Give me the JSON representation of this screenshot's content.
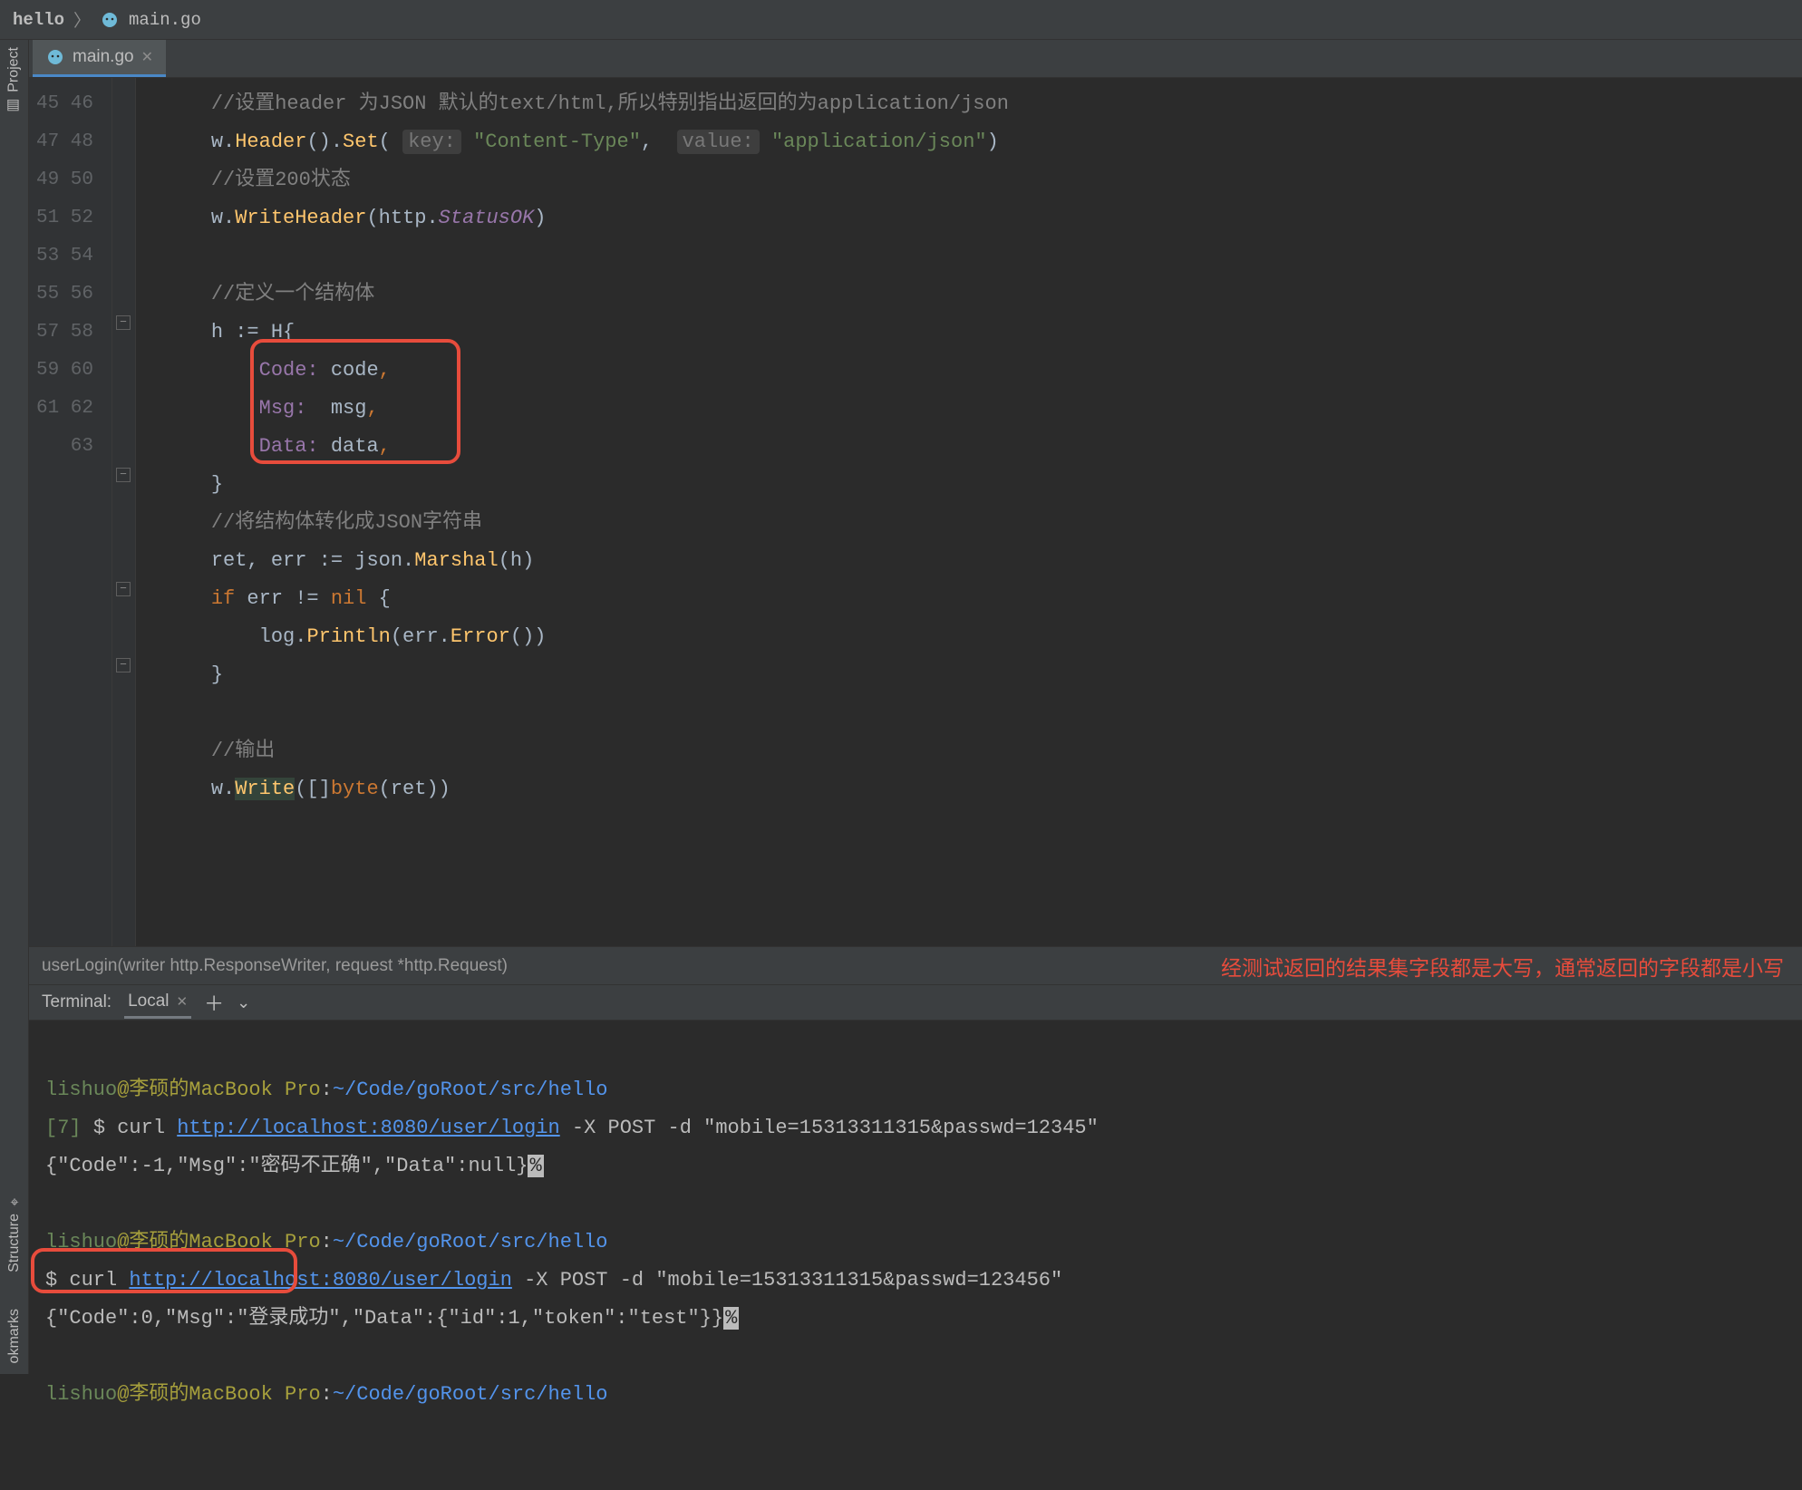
{
  "breadcrumb": {
    "root": "hello",
    "file": "main.go"
  },
  "tab": {
    "label": "main.go"
  },
  "rail": {
    "project": "Project",
    "structure": "Structure",
    "bookmarks": "okmarks"
  },
  "code": {
    "line_start": 45,
    "l45": "//设置header 为JSON 默认的text/html,所以特别指出返回的为application/json",
    "l46_pre": "w.",
    "l46_fn1": "Header",
    "l46_mid1": "().",
    "l46_fn2": "Set",
    "l46_open": "(",
    "l46_hint1": "key:",
    "l46_str1": "\"Content-Type\"",
    "l46_sep": ",  ",
    "l46_hint2": "value:",
    "l46_str2": "\"application/json\"",
    "l46_close": ")",
    "l47": "//设置200状态",
    "l48_pre": "w.",
    "l48_fn": "WriteHeader",
    "l48_open": "(http.",
    "l48_const": "StatusOK",
    "l48_close": ")",
    "l50": "//定义一个结构体",
    "l51": "h := H{",
    "l52_k": "Code:",
    "l52_v": " code",
    "l52_c": ",",
    "l53_k": "Msg:",
    "l53_v": "  msg",
    "l53_c": ",",
    "l54_k": "Data:",
    "l54_v": " data",
    "l54_c": ",",
    "l55": "}",
    "l56": "//将结构体转化成JSON字符串",
    "l57_a": "ret",
    "l57_b": ", err := json.",
    "l57_fn": "Marshal",
    "l57_c": "(h)",
    "l58_a": "if ",
    "l58_b": "err != ",
    "l58_nil": "nil",
    "l58_c": " {",
    "l59_a": "log.",
    "l59_fn": "Println",
    "l59_b": "(err.",
    "l59_fn2": "Error",
    "l59_c": "())",
    "l60": "}",
    "l62": "//输出",
    "l63_a": "w.",
    "l63_fn": "Write",
    "l63_b": "([]",
    "l63_kw": "byte",
    "l63_c": "(ret))"
  },
  "context": "userLogin(writer http.ResponseWriter, request *http.Request)",
  "annotation": "经测试返回的结果集字段都是大写，通常返回的字段都是小写",
  "terminal": {
    "title": "Terminal:",
    "tab": "Local",
    "user": "lishuo",
    "host": "@李硕的MacBook Pro",
    "pathsep": ":",
    "path": "~/Code/goRoot/src/hello",
    "job": "[7]",
    "prompt": "$ ",
    "cmd1_a": "curl ",
    "cmd1_url": "http://localhost:8080/user/login",
    "cmd1_b": " -X POST -d \"mobile=15313311315&passwd=12345\"",
    "out1": "{\"Code\":-1,\"Msg\":\"密码不正确\",\"Data\":null}",
    "cmd2_a": "curl ",
    "cmd2_url": "http://localhost:8080/user/login",
    "cmd2_b": " -X POST -d \"mobile=15313311315&passwd=123456\"",
    "out2": "{\"Code\":0,\"Msg\":\"登录成功\",\"Data\":{\"id\":1,\"token\":\"test\"}}",
    "pct": "%"
  }
}
